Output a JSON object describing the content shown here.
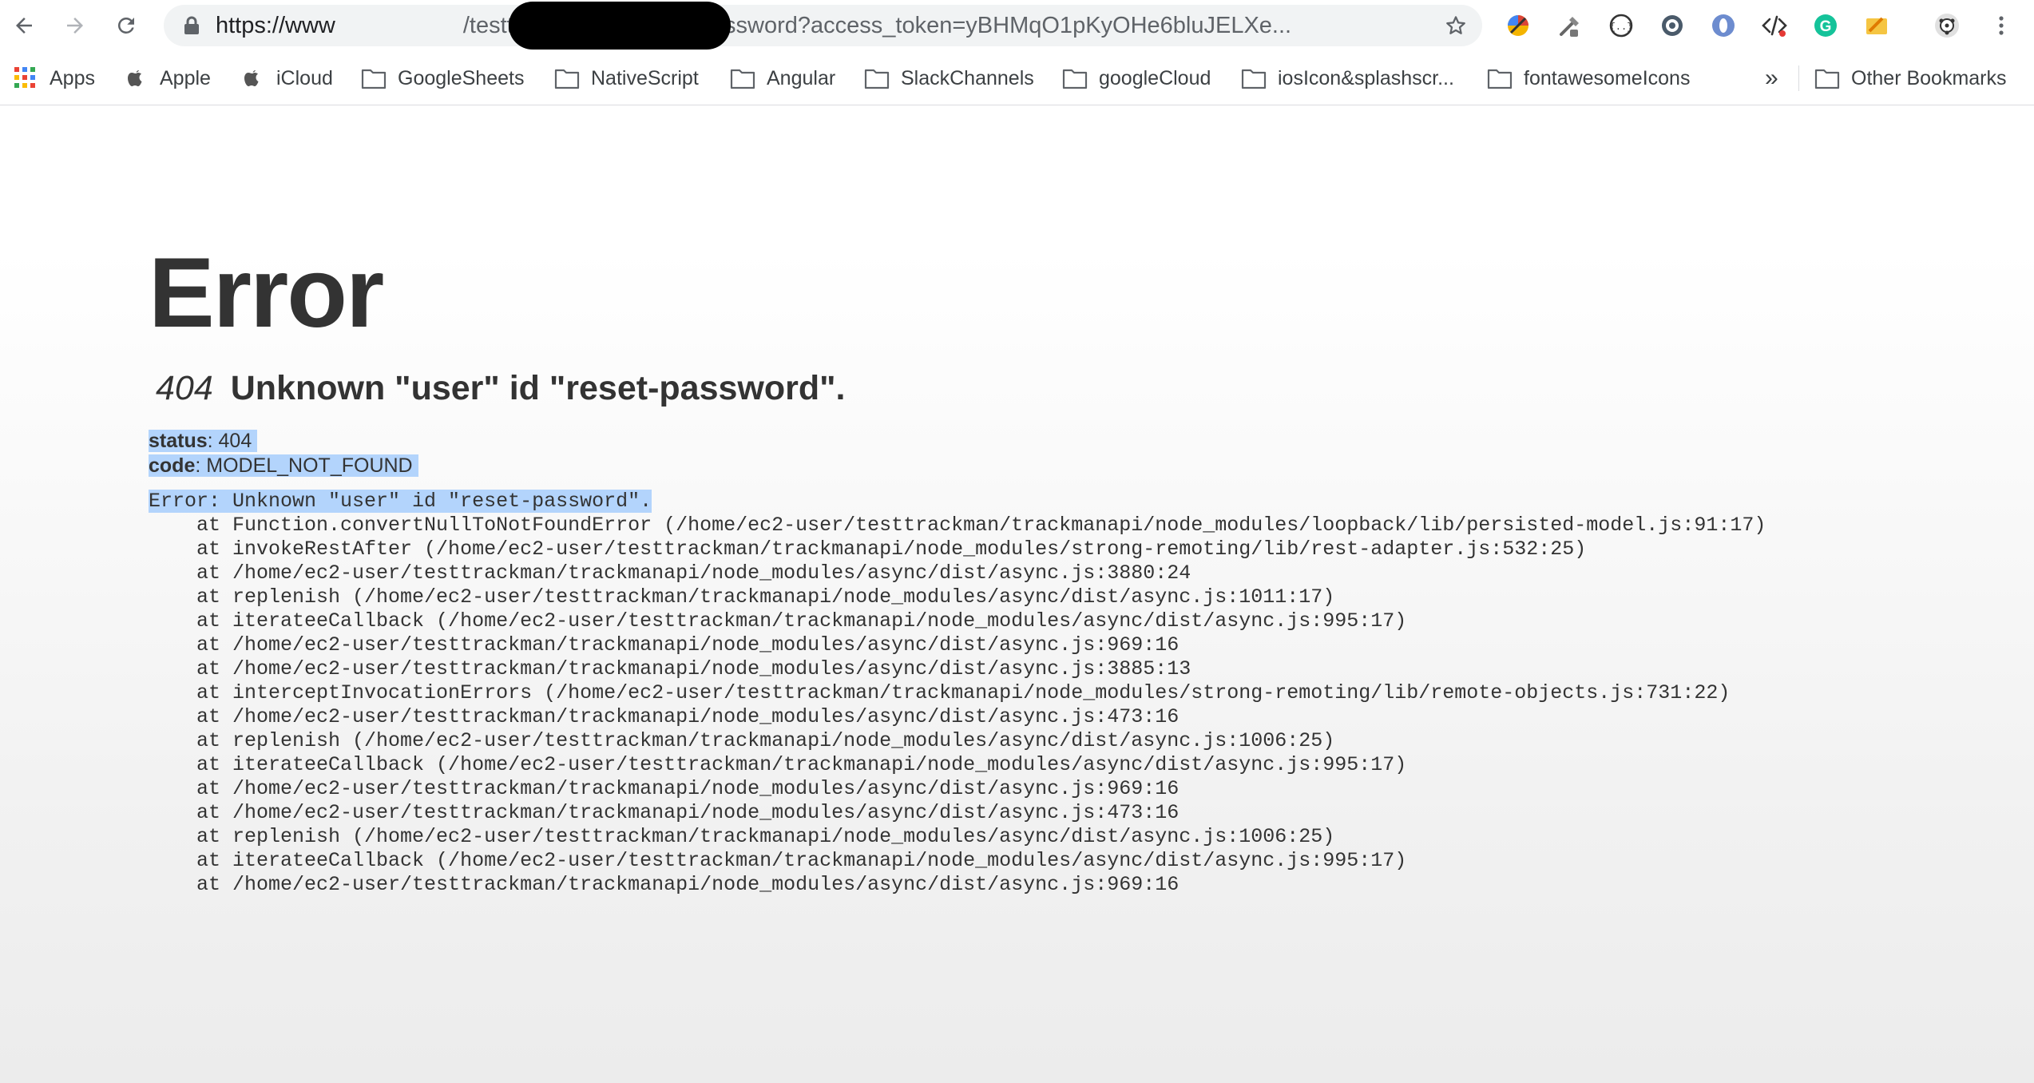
{
  "browser": {
    "url_scheme": "https://www",
    "url_path": "/testtm/api/users/reset-password?access_token=yBHMqO1pKyOHe6bluJELXe..."
  },
  "bookmarks": [
    {
      "label": "Apps",
      "icon": "apps-grid-icon"
    },
    {
      "label": "Apple",
      "icon": "apple-icon"
    },
    {
      "label": "iCloud",
      "icon": "apple-icon"
    },
    {
      "label": "GoogleSheets",
      "icon": "folder-icon"
    },
    {
      "label": "NativeScript",
      "icon": "folder-icon"
    },
    {
      "label": "Angular",
      "icon": "folder-icon"
    },
    {
      "label": "SlackChannels",
      "icon": "folder-icon"
    },
    {
      "label": "googleCloud",
      "icon": "folder-icon"
    },
    {
      "label": "iosIcon&splashscr...",
      "icon": "folder-icon"
    },
    {
      "label": "fontawesomeIcons",
      "icon": "folder-icon"
    }
  ],
  "bookmarks_overflow": "»",
  "other_bookmarks": "Other Bookmarks",
  "error": {
    "title": "Error",
    "status_code": "404",
    "message": "Unknown \"user\" id \"reset-password\".",
    "status_label": "status",
    "status_value": ": 404",
    "code_label": "code",
    "code_value": ": MODEL_NOT_FOUND",
    "stack_head": "Error: Unknown \"user\" id \"reset-password\".",
    "stack": [
      "    at Function.convertNullToNotFoundError (/home/ec2-user/testtrackman/trackmanapi/node_modules/loopback/lib/persisted-model.js:91:17)",
      "    at invokeRestAfter (/home/ec2-user/testtrackman/trackmanapi/node_modules/strong-remoting/lib/rest-adapter.js:532:25)",
      "    at /home/ec2-user/testtrackman/trackmanapi/node_modules/async/dist/async.js:3880:24",
      "    at replenish (/home/ec2-user/testtrackman/trackmanapi/node_modules/async/dist/async.js:1011:17)",
      "    at iterateeCallback (/home/ec2-user/testtrackman/trackmanapi/node_modules/async/dist/async.js:995:17)",
      "    at /home/ec2-user/testtrackman/trackmanapi/node_modules/async/dist/async.js:969:16",
      "    at /home/ec2-user/testtrackman/trackmanapi/node_modules/async/dist/async.js:3885:13",
      "    at interceptInvocationErrors (/home/ec2-user/testtrackman/trackmanapi/node_modules/strong-remoting/lib/remote-objects.js:731:22)",
      "    at /home/ec2-user/testtrackman/trackmanapi/node_modules/async/dist/async.js:473:16",
      "    at replenish (/home/ec2-user/testtrackman/trackmanapi/node_modules/async/dist/async.js:1006:25)",
      "    at iterateeCallback (/home/ec2-user/testtrackman/trackmanapi/node_modules/async/dist/async.js:995:17)",
      "    at /home/ec2-user/testtrackman/trackmanapi/node_modules/async/dist/async.js:969:16",
      "    at /home/ec2-user/testtrackman/trackmanapi/node_modules/async/dist/async.js:473:16",
      "    at replenish (/home/ec2-user/testtrackman/trackmanapi/node_modules/async/dist/async.js:1006:25)",
      "    at iterateeCallback (/home/ec2-user/testtrackman/trackmanapi/node_modules/async/dist/async.js:995:17)",
      "    at /home/ec2-user/testtrackman/trackmanapi/node_modules/async/dist/async.js:969:16"
    ]
  },
  "colors": {
    "selection": "#b3d4fc",
    "text": "#333333",
    "omnibox_bg": "#f1f3f4"
  }
}
